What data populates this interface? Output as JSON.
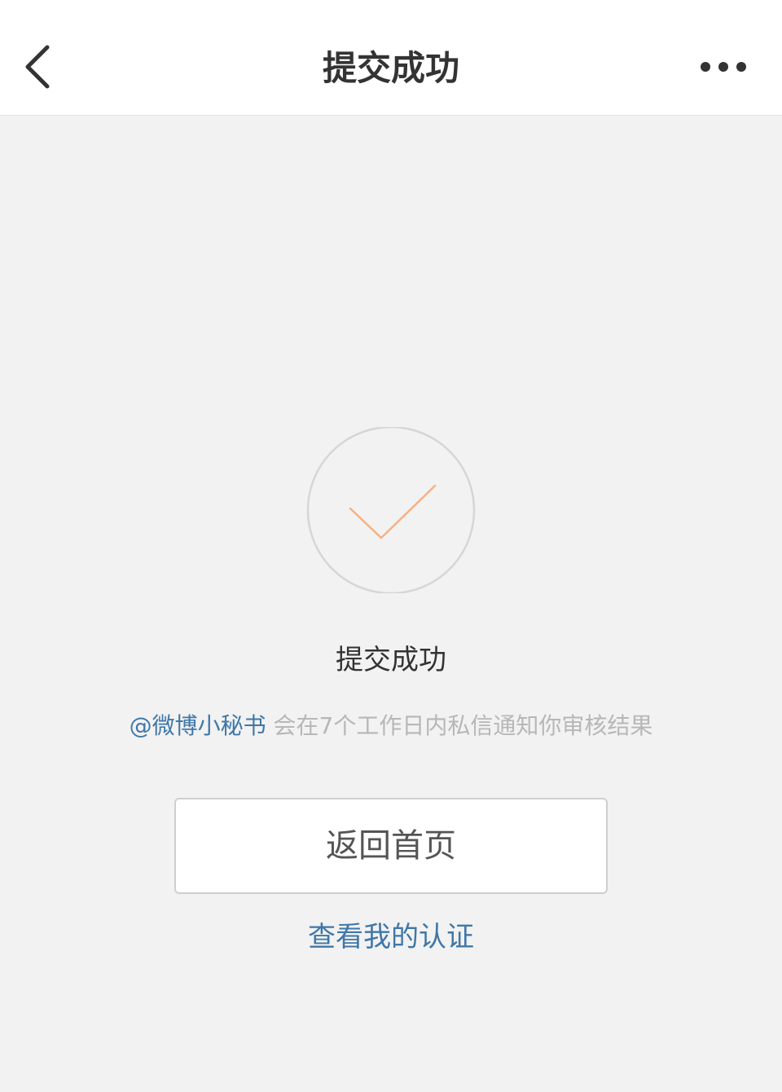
{
  "nav": {
    "title": "提交成功",
    "back_icon": "chevron-left-icon",
    "more_icon": "more-horizontal-icon"
  },
  "status": {
    "icon": "checkmark-icon",
    "title": "提交成功",
    "check_color": "#f6b184",
    "circle_color": "#d6d6d6"
  },
  "notice": {
    "mention": "@微博小秘书",
    "text": " 会在7个工作日内私信通知你审核结果"
  },
  "actions": {
    "home_button_label": "返回首页",
    "view_cert_label": "查看我的认证"
  },
  "colors": {
    "link": "#3f77a8",
    "background": "#f2f2f2"
  }
}
